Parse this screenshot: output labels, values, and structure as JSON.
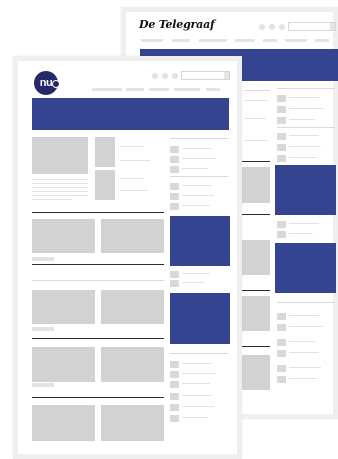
{
  "back_site": {
    "logo_text": "De Telegraaf"
  },
  "front_site": {
    "logo_text": "nu"
  },
  "colors": {
    "accent": "#344491",
    "placeholder": "#d2d2d2",
    "frame": "#efefef"
  }
}
